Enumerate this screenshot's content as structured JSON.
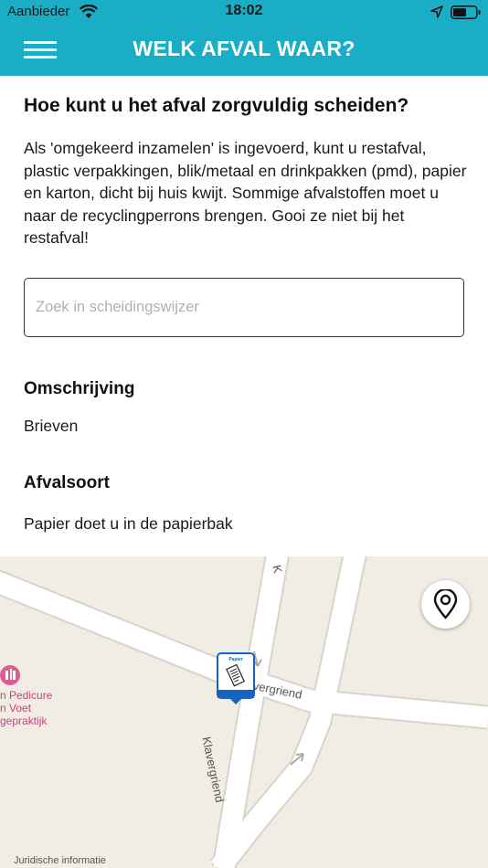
{
  "status_bar": {
    "carrier": "Aanbieder",
    "time": "18:02"
  },
  "nav": {
    "title": "WELK AFVAL WAAR?",
    "menu_icon": "hamburger-menu-icon"
  },
  "content": {
    "heading": "Hoe kunt u het afval zorgvuldig scheiden?",
    "intro": "Als 'omgekeerd inzamelen' is ingevoerd, kunt u restafval, plastic verpakkingen, blik/metaal en drinkpakken (pmd), papier en karton, dicht bij huis kwijt. Sommige afvalstoffen moet u naar de recyclingperrons brengen. Gooi ze niet bij het restafval!",
    "search": {
      "placeholder": "Zoek in scheidingswijzer",
      "value": ""
    },
    "description": {
      "label": "Omschrijving",
      "value": "Brieven"
    },
    "waste_type": {
      "label": "Afvalsoort",
      "value": "Papier doet u in de papierbak"
    }
  },
  "map": {
    "poi": {
      "line1": "n Pedicure",
      "line2": "n Voet",
      "line3": "gepraktijk"
    },
    "road_labels": [
      "Klavergriend",
      "Klavergriend",
      "K"
    ],
    "marker": {
      "label": "Papier",
      "color": "#1565c0"
    },
    "legal": "Juridische informatie"
  },
  "colors": {
    "header": "#19aec6",
    "map_bg": "#f2ede4",
    "poi": "#e25a93"
  }
}
